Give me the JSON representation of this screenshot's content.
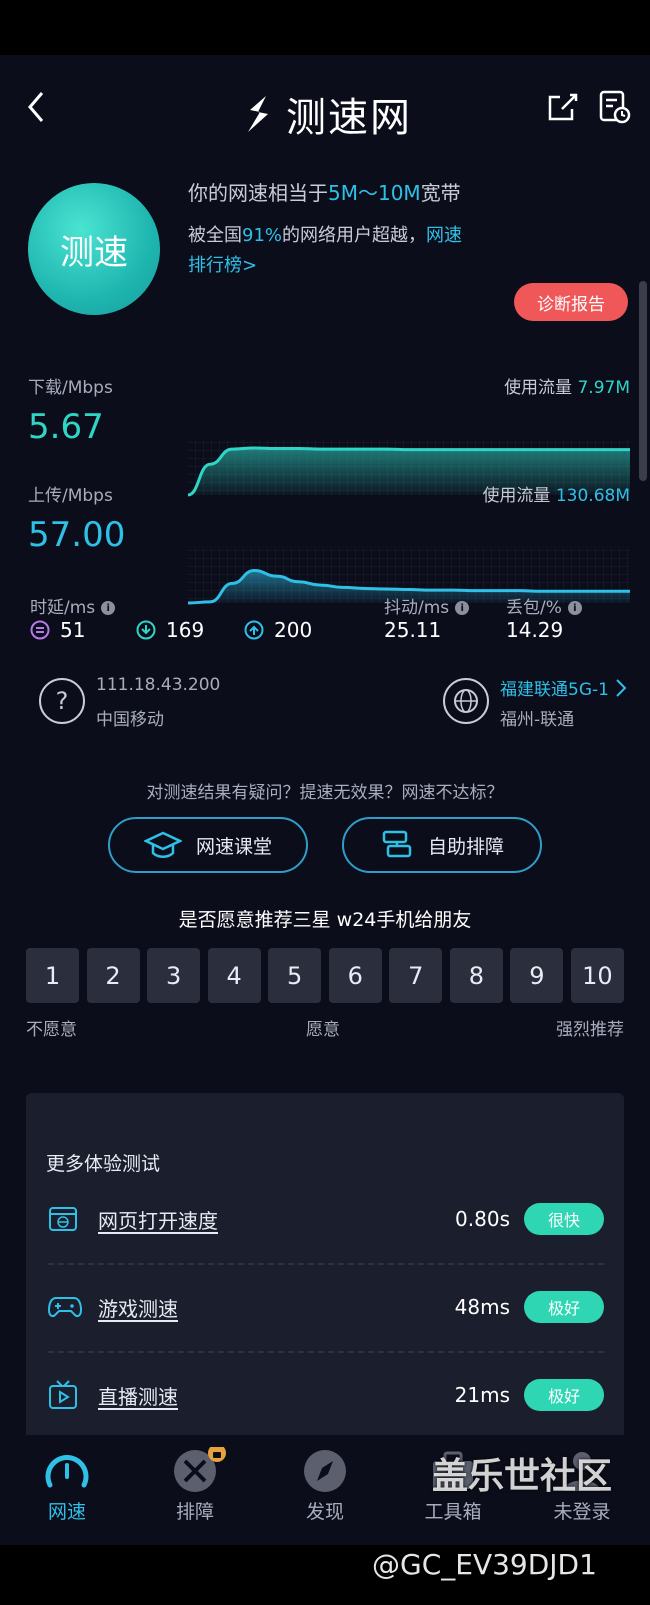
{
  "header": {
    "title": "测速网"
  },
  "summary": {
    "circle_label": "测速",
    "line1_prefix": "你的网速相当于",
    "line1_highlight": "5M～10M",
    "line1_suffix": "宽带",
    "line2_prefix": "被全国",
    "line2_pct": "91%",
    "line2_mid": "的网络用户超越，",
    "line2_link1": "网速",
    "line2_link2": "排行榜>",
    "report_button": "诊断报告"
  },
  "download": {
    "label": "下载/Mbps",
    "value": "5.67",
    "traffic_label": "使用流量",
    "traffic_value": "7.97M",
    "curve": [
      0.0,
      0.55,
      0.82,
      0.84,
      0.83,
      0.83,
      0.82,
      0.82,
      0.82,
      0.82,
      0.81,
      0.81,
      0.81,
      0.81,
      0.81,
      0.81,
      0.81,
      0.81,
      0.81,
      0.81,
      0.81
    ]
  },
  "upload": {
    "label": "上传/Mbps",
    "value": "57.00",
    "traffic_label": "使用流量",
    "traffic_value": "130.68M",
    "curve": [
      0.0,
      0.02,
      0.35,
      0.58,
      0.48,
      0.38,
      0.32,
      0.28,
      0.26,
      0.25,
      0.24,
      0.23,
      0.23,
      0.22,
      0.22,
      0.22,
      0.21,
      0.21,
      0.21,
      0.21,
      0.21
    ]
  },
  "metrics": {
    "latency_label": "时延/ms",
    "latency_values": [
      "51",
      "169",
      "200"
    ],
    "jitter_label": "抖动/ms",
    "jitter_value": "25.11",
    "loss_label": "丢包/%",
    "loss_value": "14.29"
  },
  "network": {
    "ip": "111.18.43.200",
    "isp": "中国移动",
    "server_name": "福建联通5G-1",
    "server_city": "福州-联通"
  },
  "help": {
    "question": "对测速结果有疑问？提速无效果？网速不达标？",
    "btn_course": "网速课堂",
    "btn_troubleshoot": "自助排障"
  },
  "nps": {
    "question": "是否愿意推荐三星 w24手机给朋友",
    "scores": [
      "1",
      "2",
      "3",
      "4",
      "5",
      "6",
      "7",
      "8",
      "9",
      "10"
    ],
    "left_label": "不愿意",
    "mid_label": "愿意",
    "right_label": "强烈推荐"
  },
  "more_tests": {
    "title": "更多体验测试",
    "rows": [
      {
        "label": "网页打开速度",
        "value": "0.80s",
        "rating": "很快",
        "icon": "browser-icon"
      },
      {
        "label": "游戏测速",
        "value": "48ms",
        "rating": "极好",
        "icon": "gamepad-icon"
      },
      {
        "label": "直播测速",
        "value": "21ms",
        "rating": "极好",
        "icon": "tv-icon"
      }
    ]
  },
  "tabs": [
    {
      "label": "网速",
      "icon": "speedometer-icon",
      "active": true
    },
    {
      "label": "排障",
      "icon": "tools-icon",
      "active": false
    },
    {
      "label": "发现",
      "icon": "compass-icon",
      "active": false
    },
    {
      "label": "工具箱",
      "icon": "toolbox-icon",
      "active": false
    },
    {
      "label": "未登录",
      "icon": "user-icon",
      "active": false
    }
  ],
  "watermark": {
    "brand": "盖乐世社区",
    "handle": "@GC_EV39DJD1"
  },
  "colors": {
    "accent_teal": "#2fd6c6",
    "accent_blue": "#2fc0e8",
    "report_red": "#ef5759",
    "background": "#0b0d1a"
  }
}
